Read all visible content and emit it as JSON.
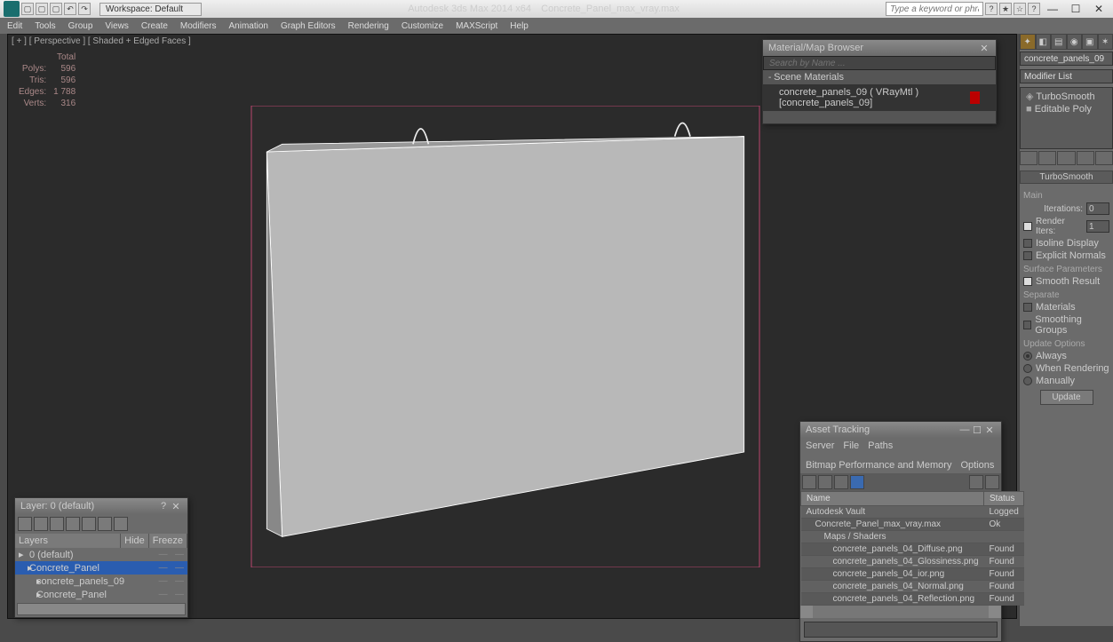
{
  "title": {
    "app": "Autodesk 3ds Max  2014 x64",
    "file": "Concrete_Panel_max_vray.max",
    "workspace": "Workspace: Default",
    "search_ph": "Type a keyword or phrase"
  },
  "menu": [
    "Edit",
    "Tools",
    "Group",
    "Views",
    "Create",
    "Modifiers",
    "Animation",
    "Graph Editors",
    "Rendering",
    "Customize",
    "MAXScript",
    "Help"
  ],
  "vp": {
    "label": "[ + ] [ Perspective ] [ Shaded + Edged Faces ]"
  },
  "stats": {
    "h": "Total",
    "polys_l": "Polys:",
    "polys": "596",
    "tris_l": "Tris:",
    "tris": "596",
    "edges_l": "Edges:",
    "edges": "1 788",
    "verts_l": "Verts:",
    "verts": "316"
  },
  "cp": {
    "obj": "concrete_panels_09",
    "modlbl": "Modifier List",
    "mods": [
      "TurboSmooth",
      "Editable Poly"
    ],
    "roll": "TurboSmooth",
    "main": "Main",
    "iter_l": "Iterations:",
    "iter": "0",
    "rend_l": "Render Iters:",
    "rend": "1",
    "iso": "Isoline Display",
    "expn": "Explicit Normals",
    "surf": "Surface Parameters",
    "smooth": "Smooth Result",
    "sep": "Separate",
    "mat": "Materials",
    "sg": "Smoothing Groups",
    "upd": "Update Options",
    "always": "Always",
    "wr": "When Rendering",
    "man": "Manually",
    "btn": "Update"
  },
  "mb": {
    "title": "Material/Map Browser",
    "search": "Search by Name ...",
    "section": "Scene Materials",
    "item": "concrete_panels_09  ( VRayMtl )  [concrete_panels_09]"
  },
  "layers": {
    "title": "Layer: 0 (default)",
    "h1": "Layers",
    "h2": "Hide",
    "h3": "Freeze",
    "rows": [
      {
        "t": "0 (default)",
        "i": 0
      },
      {
        "t": "Concrete_Panel",
        "i": 1,
        "sel": true
      },
      {
        "t": "concrete_panels_09",
        "i": 2
      },
      {
        "t": "Concrete_Panel",
        "i": 2
      }
    ]
  },
  "at": {
    "title": "Asset Tracking",
    "menu": [
      "Server",
      "File",
      "Paths",
      "Bitmap Performance and Memory",
      "Options"
    ],
    "cols": [
      "Name",
      "Status"
    ],
    "rows": [
      {
        "n": "Autodesk Vault",
        "s": "Logged",
        "i": 0
      },
      {
        "n": "Concrete_Panel_max_vray.max",
        "s": "Ok",
        "i": 1
      },
      {
        "n": "Maps / Shaders",
        "s": "",
        "i": 2
      },
      {
        "n": "concrete_panels_04_Diffuse.png",
        "s": "Found",
        "i": 3
      },
      {
        "n": "concrete_panels_04_Glossiness.png",
        "s": "Found",
        "i": 3
      },
      {
        "n": "concrete_panels_04_ior.png",
        "s": "Found",
        "i": 3
      },
      {
        "n": "concrete_panels_04_Normal.png",
        "s": "Found",
        "i": 3
      },
      {
        "n": "concrete_panels_04_Reflection.png",
        "s": "Found",
        "i": 3
      }
    ]
  }
}
